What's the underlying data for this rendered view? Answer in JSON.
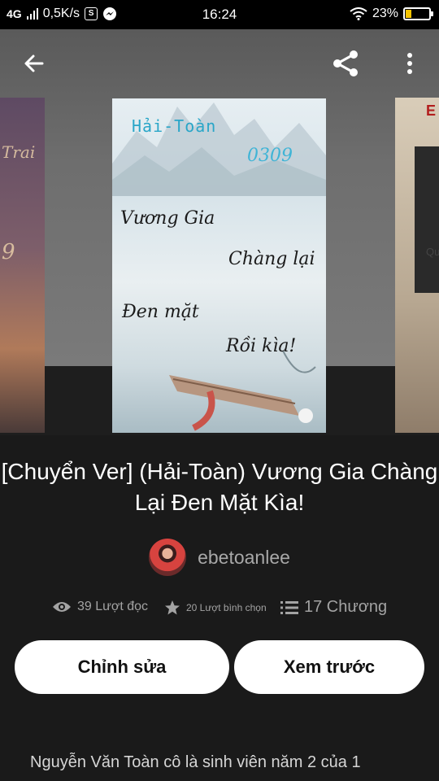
{
  "status_bar": {
    "network": "4G",
    "speed": "0,5K/s",
    "sim_badge": "S",
    "time": "16:24",
    "battery": "23%",
    "battery_level": 0.23
  },
  "header": {
    "back_icon": "arrow-left-icon",
    "share_icon": "share-icon",
    "more_icon": "more-vert-icon"
  },
  "cover": {
    "author_tag": "Hải-Toàn",
    "number_tag": "0309",
    "line1": "Vương Gia",
    "line2": "Chàng lại",
    "line3": "Đen mặt",
    "line4": "Rồi kìa!"
  },
  "side_covers": {
    "left_text": "Trai",
    "left_text2": "9",
    "right_text": "E",
    "right_caption": "Qu"
  },
  "story": {
    "title": "[Chuyển Ver] (Hải-Toàn) Vương Gia Chàng Lại Đen Mặt Kìa!",
    "author": "ebetoanlee"
  },
  "stats": {
    "reads": "39 Lượt đọc",
    "votes": "20 Lượt bình chọn",
    "chapters": "17 Chương"
  },
  "actions": {
    "edit_label": "Chỉnh sửa",
    "preview_label": "Xem trước"
  },
  "description": "Nguyễn Văn Toàn cô là sinh viên năm 2 của 1",
  "colors": {
    "background": "#1a1a1a",
    "button_bg": "#ffffff",
    "battery": "#f5c400",
    "cover_accent": "#2aa6c8"
  }
}
